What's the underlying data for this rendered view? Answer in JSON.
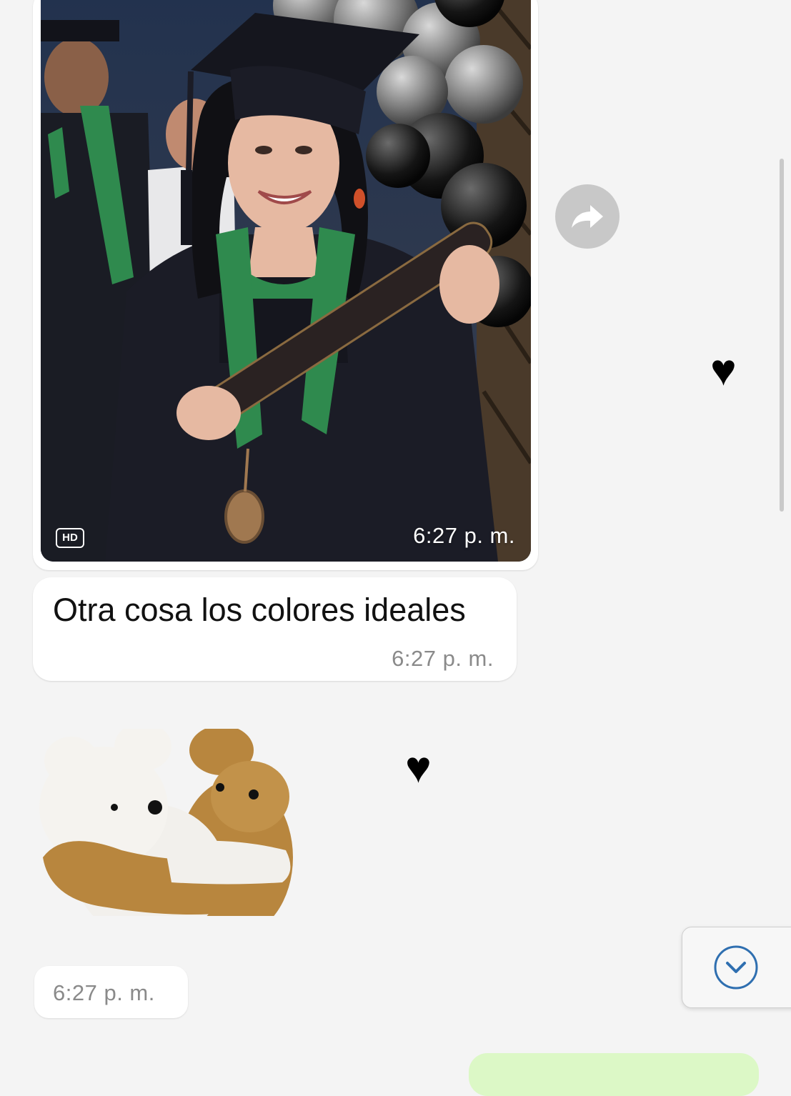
{
  "messages": [
    {
      "type": "image",
      "badge": "HD",
      "time": "6:27 p. m."
    },
    {
      "type": "text",
      "text": "Otra cosa los colores ideales",
      "time": "6:27 p. m."
    },
    {
      "type": "sticker",
      "time": "6:27 p. m."
    }
  ],
  "reactions": {
    "heart_glyph": "♥"
  },
  "icons": {
    "forward": "share-forward-icon",
    "scroll_down": "chevron-down-circle-icon"
  },
  "colors": {
    "background": "#f4f4f4",
    "bubble_incoming": "#ffffff",
    "bubble_outgoing": "#dcf8c6",
    "timestamp": "#8a8a8a",
    "accent": "#2f6fb0",
    "gown": "#1b1c26",
    "stole": "#2f8a4e"
  }
}
